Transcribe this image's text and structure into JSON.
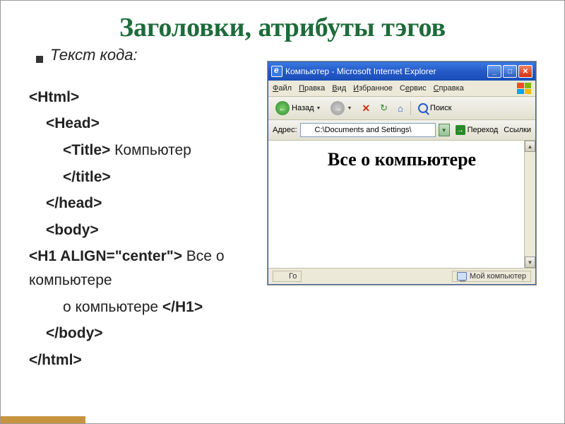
{
  "slide": {
    "title": "Заголовки, атрибуты тэгов",
    "subtitle": "Текст кода:"
  },
  "code": {
    "l1": "<Html>",
    "l2": "<Head>",
    "l3a": "<Title>",
    "l3b": " Компьютер ",
    "l3c": "</title>",
    "l4": "</head>",
    "l5": "<body>",
    "l6a": "<H1 ALIGN=\"center\">",
    "l6b": " Все о компьютере ",
    "l6c": "</H1>",
    "l7": "</body>",
    "l8": "</html>"
  },
  "ie": {
    "title": "Компьютер - Microsoft Internet Explorer",
    "menu": {
      "file": "Файл",
      "edit": "Правка",
      "view": "Вид",
      "fav": "Избранное",
      "tools": "Сервис",
      "help": "Справка"
    },
    "toolbar": {
      "back": "Назад",
      "search": "Поиск"
    },
    "address": {
      "label": "Адрес:",
      "value": "C:\\Documents and Settings\\",
      "go": "Переход",
      "links": "Ссылки"
    },
    "content_h1": "Все о компьютере",
    "status": {
      "ready": "Го",
      "zone": "Мой компьютер"
    }
  }
}
